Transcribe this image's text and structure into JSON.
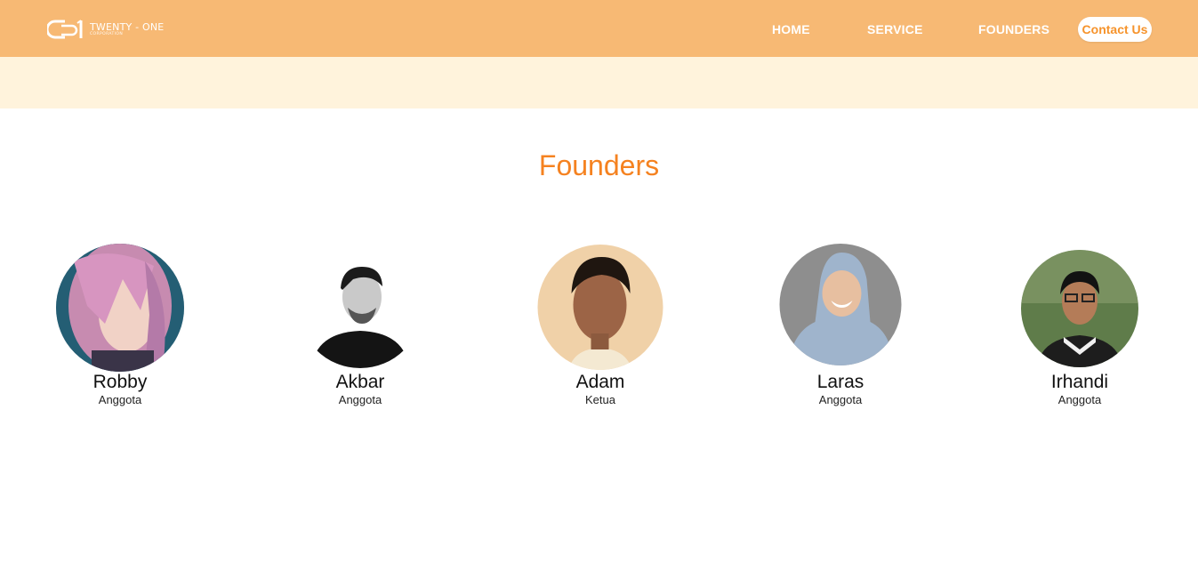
{
  "header": {
    "logo_text": "TWENTY - ONE",
    "logo_subtext": "CORPORATION",
    "nav": {
      "home": "HOME",
      "service": "SERVICE",
      "founders": "FOUNDERS",
      "contact": "Contact Us"
    }
  },
  "founders_section": {
    "title": "Founders",
    "members": [
      {
        "name": "Robby",
        "role": "Anggota"
      },
      {
        "name": "Akbar",
        "role": "Anggota"
      },
      {
        "name": "Adam",
        "role": "Ketua"
      },
      {
        "name": "Laras",
        "role": "Anggota"
      },
      {
        "name": "Irhandi",
        "role": "Anggota"
      }
    ]
  },
  "colors": {
    "navbar": "#f7b974",
    "banner": "#fff3dc",
    "accent": "#f58220"
  }
}
